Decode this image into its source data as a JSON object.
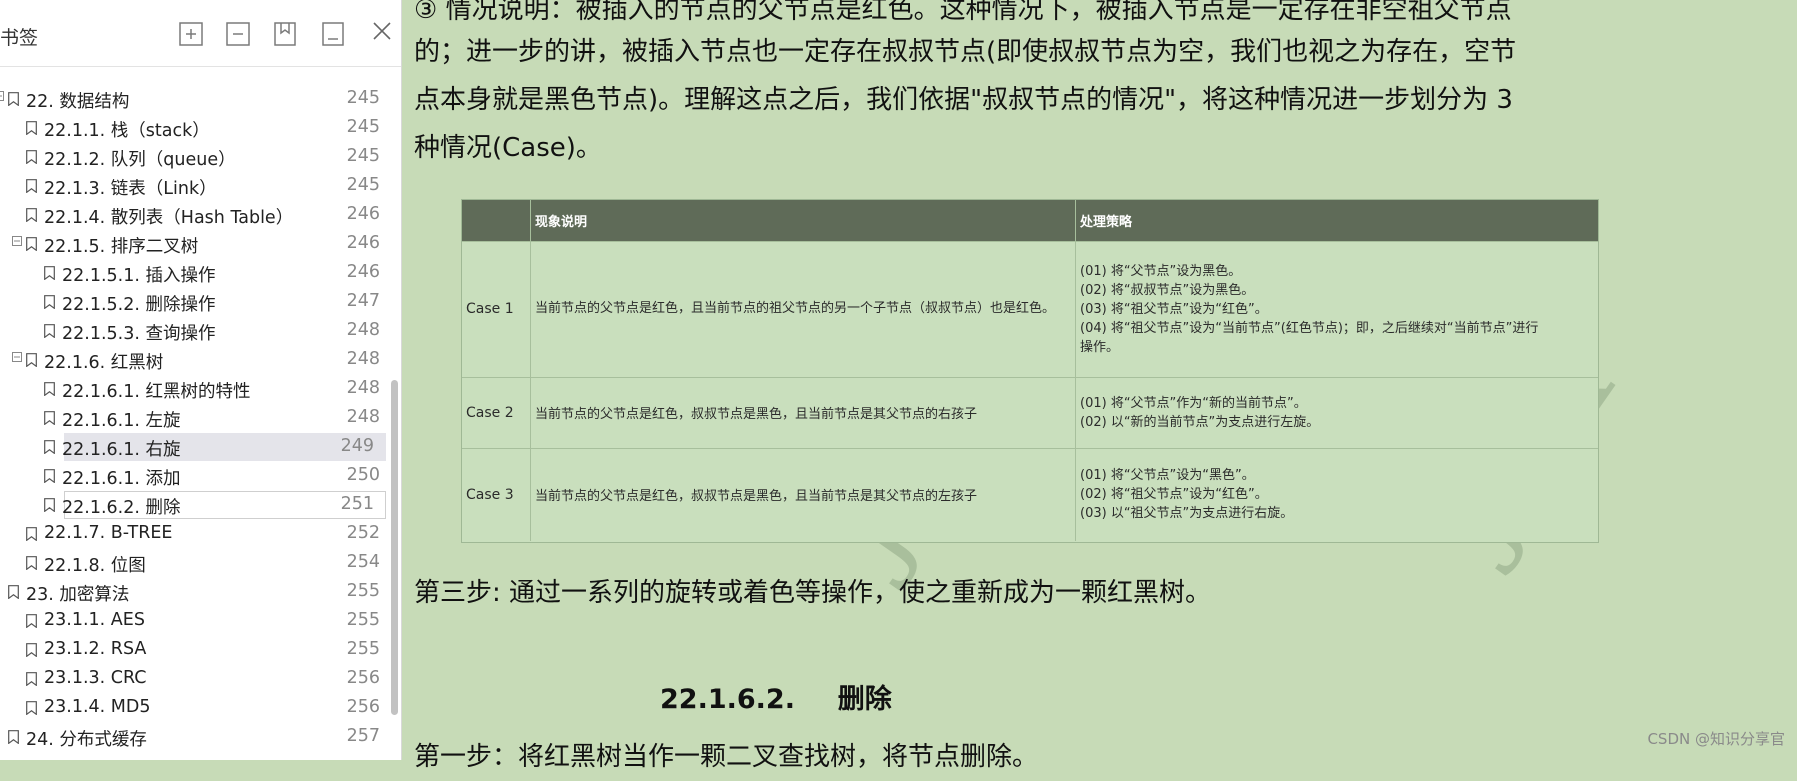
{
  "sidebar": {
    "title": "书签",
    "toolbar": [
      {
        "icon": "expand-all-icon"
      },
      {
        "icon": "collapse-all-icon"
      },
      {
        "icon": "add-bookmark-icon"
      },
      {
        "icon": "remove-bookmark-icon"
      }
    ],
    "close_icon": "close-icon",
    "items": [
      {
        "label": "22. 数据结构",
        "page": "245",
        "level": 0,
        "expandable": true
      },
      {
        "label": "22.1.1. 栈（stack）",
        "page": "245",
        "level": 1
      },
      {
        "label": "22.1.2. 队列（queue）",
        "page": "245",
        "level": 1
      },
      {
        "label": "22.1.3. 链表（Link）",
        "page": "245",
        "level": 1
      },
      {
        "label": "22.1.4. 散列表（Hash Table）",
        "page": "246",
        "level": 1
      },
      {
        "label": "22.1.5. 排序二叉树",
        "page": "246",
        "level": 1,
        "expandable": true
      },
      {
        "label": "22.1.5.1. 插入操作",
        "page": "246",
        "level": 2
      },
      {
        "label": "22.1.5.2. 删除操作",
        "page": "247",
        "level": 2
      },
      {
        "label": "22.1.5.3. 查询操作",
        "page": "248",
        "level": 2
      },
      {
        "label": "22.1.6. 红黑树",
        "page": "248",
        "level": 1,
        "expandable": true
      },
      {
        "label": "22.1.6.1. 红黑树的特性",
        "page": "248",
        "level": 2
      },
      {
        "label": "22.1.6.1. 左旋",
        "page": "248",
        "level": 2
      },
      {
        "label": "22.1.6.1. 右旋",
        "page": "249",
        "level": 2,
        "selected": true
      },
      {
        "label": "22.1.6.1. 添加",
        "page": "250",
        "level": 2
      },
      {
        "label": "22.1.6.2. 删除",
        "page": "251",
        "level": 2,
        "focused": true
      },
      {
        "label": "22.1.7. B-TREE",
        "page": "252",
        "level": 1
      },
      {
        "label": "22.1.8. 位图",
        "page": "254",
        "level": 1
      },
      {
        "label": "23. 加密算法",
        "page": "255",
        "level": 0
      },
      {
        "label": "23.1.1. AES",
        "page": "255",
        "level": 1
      },
      {
        "label": "23.1.2. RSA",
        "page": "255",
        "level": 1
      },
      {
        "label": "23.1.3. CRC",
        "page": "256",
        "level": 1
      },
      {
        "label": "23.1.4. MD5",
        "page": "256",
        "level": 1
      },
      {
        "label": "24. 分布式缓存",
        "page": "257",
        "level": 0
      }
    ]
  },
  "document": {
    "paragraphs": [
      "③ 情况说明：被插入的节点的父节点是红色。这种情况下，被插入节点是一定存在非空祖父节点",
      "的；进一步的讲，被插入节点也一定存在叔叔节点(即使叔叔节点为空，我们也视之为存在，空节",
      "点本身就是黑色节点)。理解这点之后，我们依据\"叔叔节点的情况\"，将这种情况进一步划分为 3",
      "种情况(Case)。"
    ],
    "table": {
      "headers": [
        "",
        "现象说明",
        "处理策略"
      ],
      "rows": [
        {
          "case": "Case 1",
          "description": "当前节点的父节点是红色，且当前节点的祖父节点的另一个子节点（叔叔节点）也是红色。",
          "strategy": [
            "(01) 将“父节点”设为黑色。",
            "(02) 将“叔叔节点”设为黑色。",
            "(03) 将“祖父节点”设为“红色”。",
            "(04) 将“祖父节点”设为“当前节点”(红色节点)；即，之后继续对“当前节点”进行",
            "操作。"
          ]
        },
        {
          "case": "Case 2",
          "description": "当前节点的父节点是红色，叔叔节点是黑色，且当前节点是其父节点的右孩子",
          "strategy": [
            "(01) 将“父节点”作为“新的当前节点”。",
            "(02) 以“新的当前节点”为支点进行左旋。"
          ]
        },
        {
          "case": "Case 3",
          "description": "当前节点的父节点是红色，叔叔节点是黑色，且当前节点是其父节点的左孩子",
          "strategy": [
            "(01) 将“父节点”设为“黑色”。",
            "(02) 将“祖父节点”设为“红色”。",
            "(03) 以“祖父节点”为支点进行右旋。"
          ]
        }
      ]
    },
    "step3": "第三步: 通过一系列的旋转或着色等操作，使之重新成为一颗红黑树。",
    "heading_num": "22.1.6.2.",
    "heading_text": "删除",
    "step1": "第一步：将红黑树当作一颗二叉查找树，将节点删除。",
    "watermark": "JDX",
    "credit": "CSDN @知识分享官"
  }
}
